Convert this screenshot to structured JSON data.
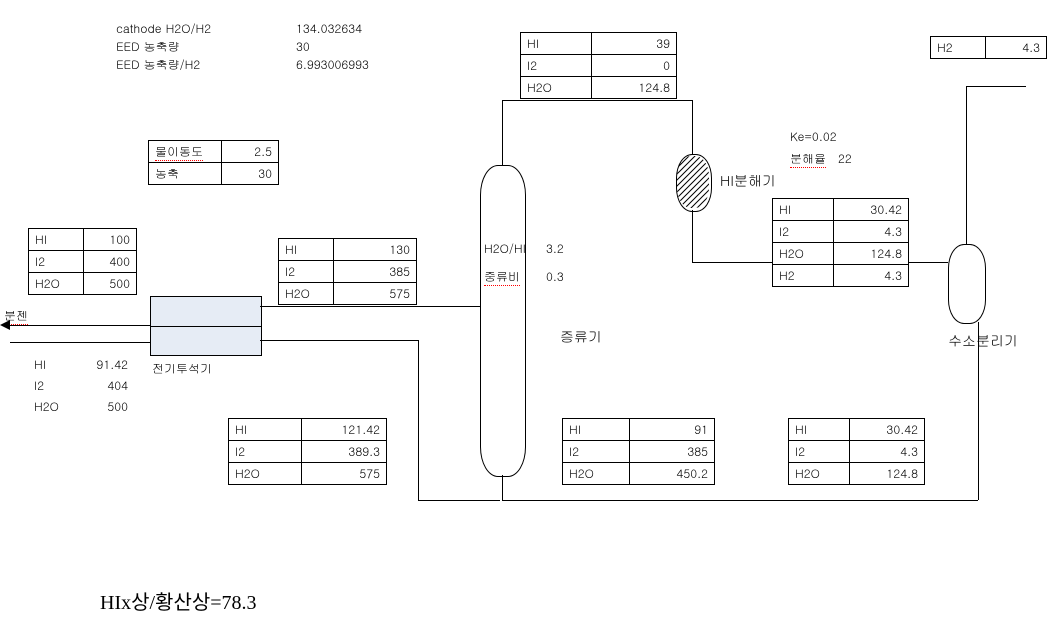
{
  "header": {
    "row1_label": "cathode H2O/H2",
    "row1_value": "134.032634",
    "row2_label": "EED 농축량",
    "row2_value": "30",
    "row3_label": "EED 농축량/H2",
    "row3_value": "6.993006993"
  },
  "params_box": {
    "r1_label": "물이동도",
    "r1_value": "2.5",
    "r2_label": "농축",
    "r2_value": "30"
  },
  "feed_in": {
    "r1_k": "HI",
    "r1_v": "100",
    "r2_k": "I2",
    "r2_v": "400",
    "r3_k": "H2O",
    "r3_v": "500"
  },
  "bullet_label": "분젠",
  "ed_out": {
    "r1_k": "HI",
    "r1_v": "130",
    "r2_k": "I2",
    "r2_v": "385",
    "r3_k": "H2O",
    "r3_v": "575"
  },
  "recycle_vals": {
    "r1_k": "HI",
    "r1_v": "91.42",
    "r2_k": "I2",
    "r2_v": "404",
    "r3_k": "H2O",
    "r3_v": "500"
  },
  "ed_label": "전기투석기",
  "dist_feed_lower": {
    "r1_k": "HI",
    "r1_v": "121.42",
    "r2_k": "I2",
    "r2_v": "389.3",
    "r3_k": "H2O",
    "r3_v": "575"
  },
  "dist_top": {
    "r1_k": "HI",
    "r1_v": "39",
    "r2_k": "I2",
    "r2_v": "0",
    "r3_k": "H2O",
    "r3_v": "124.8"
  },
  "dist_params": {
    "p1_k": "H2O/HI",
    "p1_v": "3.2",
    "p2_k": "중류비",
    "p2_v": "0.3"
  },
  "dist_label": "증류기",
  "hi_decomp_label": "HI분해기",
  "ke_label": "Ke=0.02",
  "decomp_rate_label": "분해율",
  "decomp_rate_value": "22",
  "decomp_out": {
    "r1_k": "HI",
    "r1_v": "30.42",
    "r2_k": "I2",
    "r2_v": "4.3",
    "r3_k": "H2O",
    "r3_v": "124.8",
    "r4_k": "H2",
    "r4_v": "4.3"
  },
  "h2_product": {
    "k": "H2",
    "v": "4.3"
  },
  "h2sep_label": "수소분리기",
  "dist_bottom": {
    "r1_k": "HI",
    "r1_v": "91",
    "r2_k": "I2",
    "r2_v": "385",
    "r3_k": "H2O",
    "r3_v": "450.2"
  },
  "h2sep_bottom": {
    "r1_k": "HI",
    "r1_v": "30.42",
    "r2_k": "I2",
    "r2_v": "4.3",
    "r3_k": "H2O",
    "r3_v": "124.8"
  },
  "footer": "HIx상/황산상=78.3"
}
